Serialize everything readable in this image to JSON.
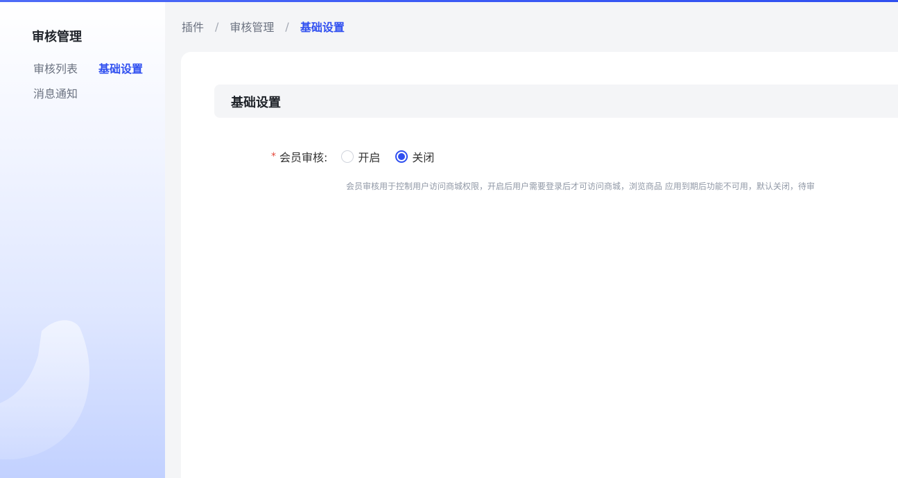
{
  "sidebar": {
    "title": "审核管理",
    "items": [
      {
        "label": "审核列表",
        "active": false
      },
      {
        "label": "基础设置",
        "active": true
      },
      {
        "label": "消息通知",
        "active": false
      }
    ]
  },
  "breadcrumb": {
    "items": [
      "插件",
      "审核管理",
      "基础设置"
    ],
    "separator": "/"
  },
  "section": {
    "title": "基础设置"
  },
  "form": {
    "required_mark": "*",
    "member_review_label": "会员审核:",
    "options": [
      {
        "label": "开启",
        "checked": false
      },
      {
        "label": "关闭",
        "checked": true
      }
    ],
    "help_text": "会员审核用于控制用户访问商城权限，开启后用户需要登录后才可访问商城，浏览商品 应用到期后功能不可用，默认关闭，待审"
  },
  "colors": {
    "accent": "#2f4ff0",
    "required": "#e5483b"
  }
}
